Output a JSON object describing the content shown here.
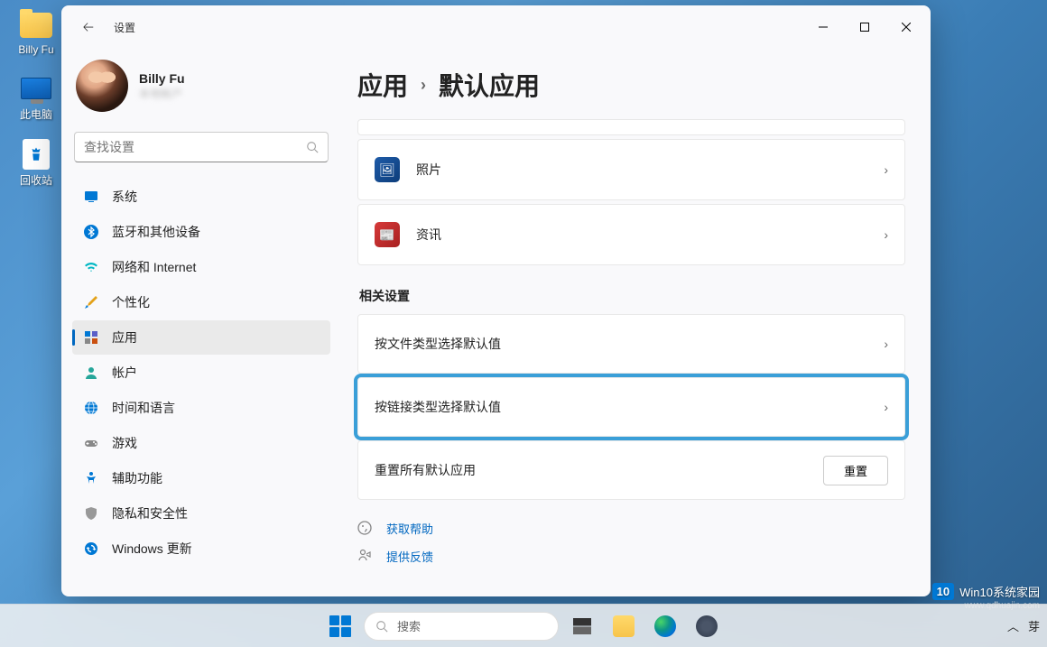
{
  "desktop": {
    "icons": [
      {
        "label": "Billy Fu",
        "type": "folder"
      },
      {
        "label": "此电脑",
        "type": "pc"
      },
      {
        "label": "回收站",
        "type": "recycle"
      }
    ]
  },
  "window": {
    "title": "设置",
    "profile": {
      "name": "Billy Fu",
      "sub": "本地帐户"
    },
    "search_placeholder": "查找设置",
    "nav": [
      {
        "id": "system",
        "label": "系统",
        "icon": "🖥️",
        "color": "#0078d4"
      },
      {
        "id": "bluetooth",
        "label": "蓝牙和其他设备",
        "icon": "bt",
        "color": "#0078d4"
      },
      {
        "id": "network",
        "label": "网络和 Internet",
        "icon": "wifi",
        "color": "#00b7c3"
      },
      {
        "id": "personalization",
        "label": "个性化",
        "icon": "brush",
        "color": "#e3a21a"
      },
      {
        "id": "apps",
        "label": "应用",
        "icon": "apps",
        "color": "#5b5fc7",
        "active": true
      },
      {
        "id": "accounts",
        "label": "帐户",
        "icon": "person",
        "color": "#26a69a"
      },
      {
        "id": "time",
        "label": "时间和语言",
        "icon": "globe",
        "color": "#0078d4"
      },
      {
        "id": "gaming",
        "label": "游戏",
        "icon": "gamepad",
        "color": "#888"
      },
      {
        "id": "accessibility",
        "label": "辅助功能",
        "icon": "accessibility",
        "color": "#0078d4"
      },
      {
        "id": "privacy",
        "label": "隐私和安全性",
        "icon": "shield",
        "color": "#888"
      },
      {
        "id": "update",
        "label": "Windows 更新",
        "icon": "update",
        "color": "#0078d4"
      }
    ],
    "breadcrumb": {
      "root": "应用",
      "current": "默认应用"
    },
    "app_cards": [
      {
        "id": "photos",
        "label": "照片"
      },
      {
        "id": "news",
        "label": "资讯"
      }
    ],
    "related_header": "相关设置",
    "related": [
      {
        "id": "by-file-type",
        "label": "按文件类型选择默认值"
      },
      {
        "id": "by-link-type",
        "label": "按链接类型选择默认值",
        "highlight": true
      },
      {
        "id": "reset-all",
        "label": "重置所有默认应用",
        "button": "重置"
      }
    ],
    "links": [
      {
        "id": "help",
        "label": "获取帮助"
      },
      {
        "id": "feedback",
        "label": "提供反馈"
      }
    ]
  },
  "taskbar": {
    "search": "搜索"
  },
  "watermark": {
    "brand": "Win10系统家园",
    "url": "www.qdhuajin.com",
    "badge": "10"
  }
}
